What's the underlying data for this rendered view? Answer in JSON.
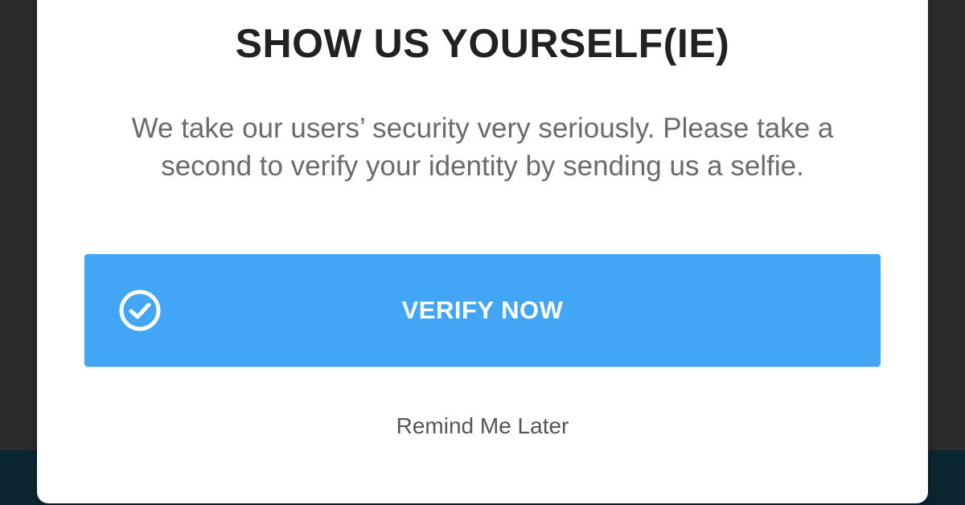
{
  "dialog": {
    "title": "SHOW US YOURSELF(IE)",
    "message": "We take our users’ security very seriously. Please take a second to verify your identity by sending us a selfie.",
    "primary_button": {
      "label": "VERIFY NOW",
      "icon": "check-circle-icon",
      "color": "#42a5f5"
    },
    "secondary_link": {
      "label": "Remind Me Later"
    }
  },
  "colors": {
    "backdrop": "#2b2b2b",
    "backdrop_bottom": "#0c2631",
    "dialog_background": "#ffffff",
    "title_text": "#222222",
    "body_text": "#6b6b6b",
    "accent": "#42a5f5"
  }
}
